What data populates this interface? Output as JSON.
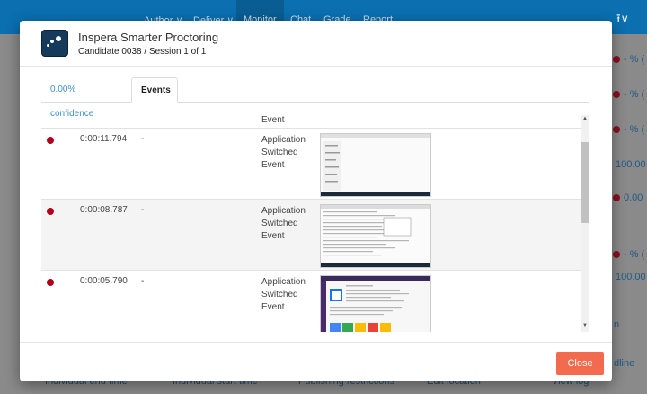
{
  "background": {
    "nav": [
      "Author ∨",
      "Deliver ∨",
      "Monitor",
      "Chat",
      "Grade",
      "Report"
    ],
    "right_values": [
      "- % (",
      "- % (",
      "- % (",
      "100.00",
      "0.00",
      "- % (",
      "100.00"
    ],
    "bottom_links": [
      "Individual end time",
      "Individual start time",
      "Publishing restrictions",
      "Edit location",
      "View log"
    ],
    "right_side_text": [
      "n",
      "dline"
    ]
  },
  "modal": {
    "title": "Inspera Smarter Proctoring",
    "subtitle": "Candidate 0038 / Session 1 of 1",
    "tabs": [
      {
        "label": "0.00% confidence"
      },
      {
        "label": "Events"
      }
    ],
    "events_header_partial": "Event",
    "events": [
      {
        "time": "0:00:11.794",
        "detail": "-",
        "type": "Application Switched Event"
      },
      {
        "time": "0:00:08.787",
        "detail": "-",
        "type": "Application Switched Event"
      },
      {
        "time": "0:00:05.790",
        "detail": "-",
        "type": "Application Switched Event"
      }
    ],
    "close_label": "Close"
  },
  "colors": {
    "accent": "#0b6fb0",
    "close": "#f26b4f",
    "dot": "#b0001b"
  },
  "icons": [
    "logo-icon",
    "upload-icon",
    "chevron-down-icon",
    "scroll-up-icon",
    "scroll-down-icon"
  ]
}
